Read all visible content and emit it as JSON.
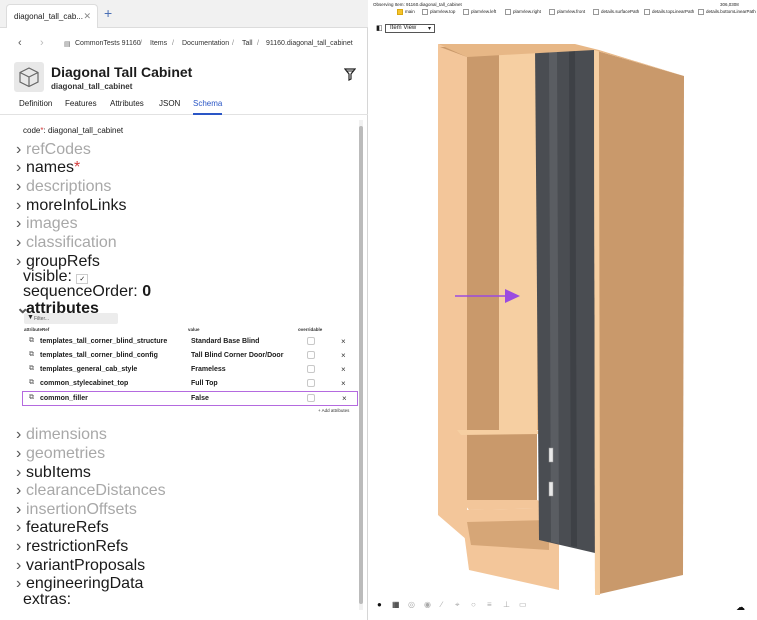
{
  "tab": {
    "title": "diagonal_tall_cab...",
    "close_icon": "close-icon",
    "add_icon": "plus-icon"
  },
  "breadcrumb": [
    "CommonTests 91160",
    "Items",
    "Documentation",
    "Tall",
    "91160.diagonal_tall_cabinet"
  ],
  "item": {
    "title": "Diagonal Tall Cabinet",
    "code": "diagonal_tall_cabinet"
  },
  "subtabs": [
    "Definition",
    "Features",
    "Attributes",
    "JSON",
    "Schema"
  ],
  "schema": {
    "code_label": "code",
    "code_value": "diagonal_tall_cabinet",
    "required_mark": "*",
    "sections": {
      "refCodes": "refCodes",
      "names": "names",
      "descriptions": "descriptions",
      "moreInfoLinks": "moreInfoLinks",
      "images": "images",
      "classification": "classification",
      "groupRefs": "groupRefs",
      "attributes": "attributes",
      "dimensions": "dimensions",
      "geometries": "geometries",
      "subItems": "subItems",
      "clearanceDistances": "clearanceDistances",
      "insertionOffsets": "insertionOffsets",
      "featureRefs": "featureRefs",
      "restrictionRefs": "restrictionRefs",
      "variantProposals": "variantProposals",
      "engineeringData": "engineeringData"
    },
    "visible_label": "visible:",
    "visible_value": "✓",
    "sequence_label": "sequenceOrder:",
    "sequence_value": "0",
    "extras_label": "extras:"
  },
  "attributes": {
    "filter_placeholder": "Filter...",
    "col_ref": "attributeRef",
    "col_value": "value",
    "col_overridable": "overridable",
    "rows": [
      {
        "ref": "templates_tall_corner_blind_structure",
        "value": "Standard Base Blind"
      },
      {
        "ref": "templates_tall_corner_blind_config",
        "value": "Tall Blind Corner Door/Door"
      },
      {
        "ref": "templates_general_cab_style",
        "value": "Frameless"
      },
      {
        "ref": "common_stylecabinet_top",
        "value": "Full Top"
      },
      {
        "ref": "common_filler",
        "value": "False"
      }
    ],
    "add_label": "+ Add attributes"
  },
  "viewer": {
    "observing": "Observing Item: 91160.diagonal_tall_cabinet",
    "size": "306,0308",
    "layers": [
      {
        "label": "main",
        "checked": true
      },
      {
        "label": "planView.top",
        "checked": false
      },
      {
        "label": "planView.left",
        "checked": false
      },
      {
        "label": "planView.right",
        "checked": false
      },
      {
        "label": "planView.front",
        "checked": false
      },
      {
        "label": "details.surfacePath",
        "checked": false
      },
      {
        "label": "details.topLinearPath",
        "checked": false
      },
      {
        "label": "details.bottomLinearPath",
        "checked": false
      }
    ],
    "view_mode": "Item View"
  },
  "colors": {
    "accent": "#2a56c6",
    "highlight": "#b46adf",
    "arrow": "#9b4be0",
    "particleboard": "#c89a6a",
    "edge": "#f6cfa2",
    "door": "#4a4d52"
  }
}
